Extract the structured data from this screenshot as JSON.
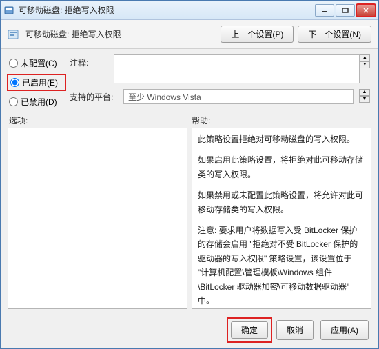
{
  "window": {
    "title": "可移动磁盘: 拒绝写入权限"
  },
  "header": {
    "title": "可移动磁盘: 拒绝写入权限",
    "prev": "上一个设置(P)",
    "next": "下一个设置(N)"
  },
  "radios": {
    "not_configured": "未配置(C)",
    "enabled": "已启用(E)",
    "disabled": "已禁用(D)"
  },
  "fields": {
    "comment_label": "注释:",
    "comment_value": "",
    "platform_label": "支持的平台:",
    "platform_value": "至少 Windows Vista"
  },
  "panels": {
    "options_label": "选项:",
    "help_label": "帮助:",
    "help_paragraphs": [
      "此策略设置拒绝对可移动磁盘的写入权限。",
      "如果启用此策略设置，将拒绝对此可移动存储类的写入权限。",
      "如果禁用或未配置此策略设置，将允许对此可移动存储类的写入权限。",
      "注意: 要求用户将数据写入受 BitLocker 保护的存储会启用 \"拒绝对不受 BitLocker 保护的驱动器的写入权限\" 策略设置，该设置位于 \"计算机配置\\管理模板\\Windows 组件\\BitLocker 驱动器加密\\可移动数据驱动器\" 中。"
    ]
  },
  "footer": {
    "ok": "确定",
    "cancel": "取消",
    "apply": "应用(A)"
  }
}
